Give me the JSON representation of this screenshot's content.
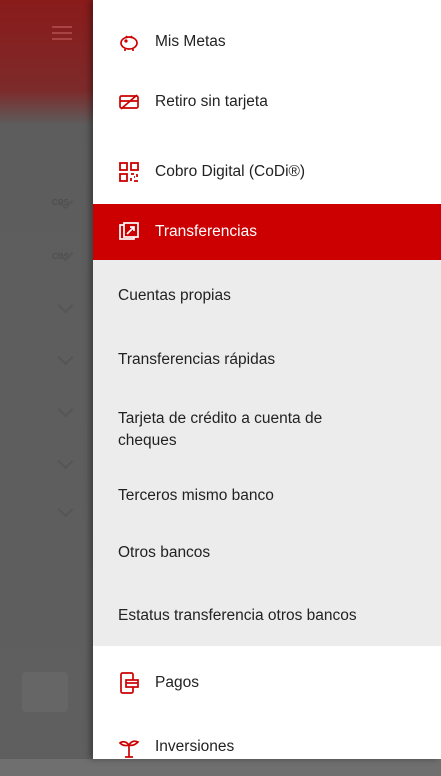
{
  "background": {
    "labels": [
      "cos",
      "cos"
    ]
  },
  "menu": {
    "items_top": [
      {
        "label": "Mis Metas",
        "icon": "piggy-bank-icon"
      },
      {
        "label": "Retiro sin tarjeta",
        "icon": "card-no-icon"
      },
      {
        "label": "Cobro Digital (CoDi®)",
        "icon": "qr-code-icon"
      }
    ],
    "active": {
      "label": "Transferencias",
      "icon": "transfer-icon"
    },
    "submenu": [
      "Cuentas propias",
      "Transferencias rápidas",
      "Tarjeta de crédito a cuenta de cheques",
      "Terceros mismo banco",
      "Otros bancos",
      "Estatus transferencia otros bancos"
    ],
    "items_bottom": [
      {
        "label": "Pagos",
        "icon": "payments-icon"
      },
      {
        "label": "Inversiones",
        "icon": "plant-icon"
      }
    ]
  },
  "colors": {
    "accent": "#cc0000",
    "submenu_bg": "#ececec"
  }
}
